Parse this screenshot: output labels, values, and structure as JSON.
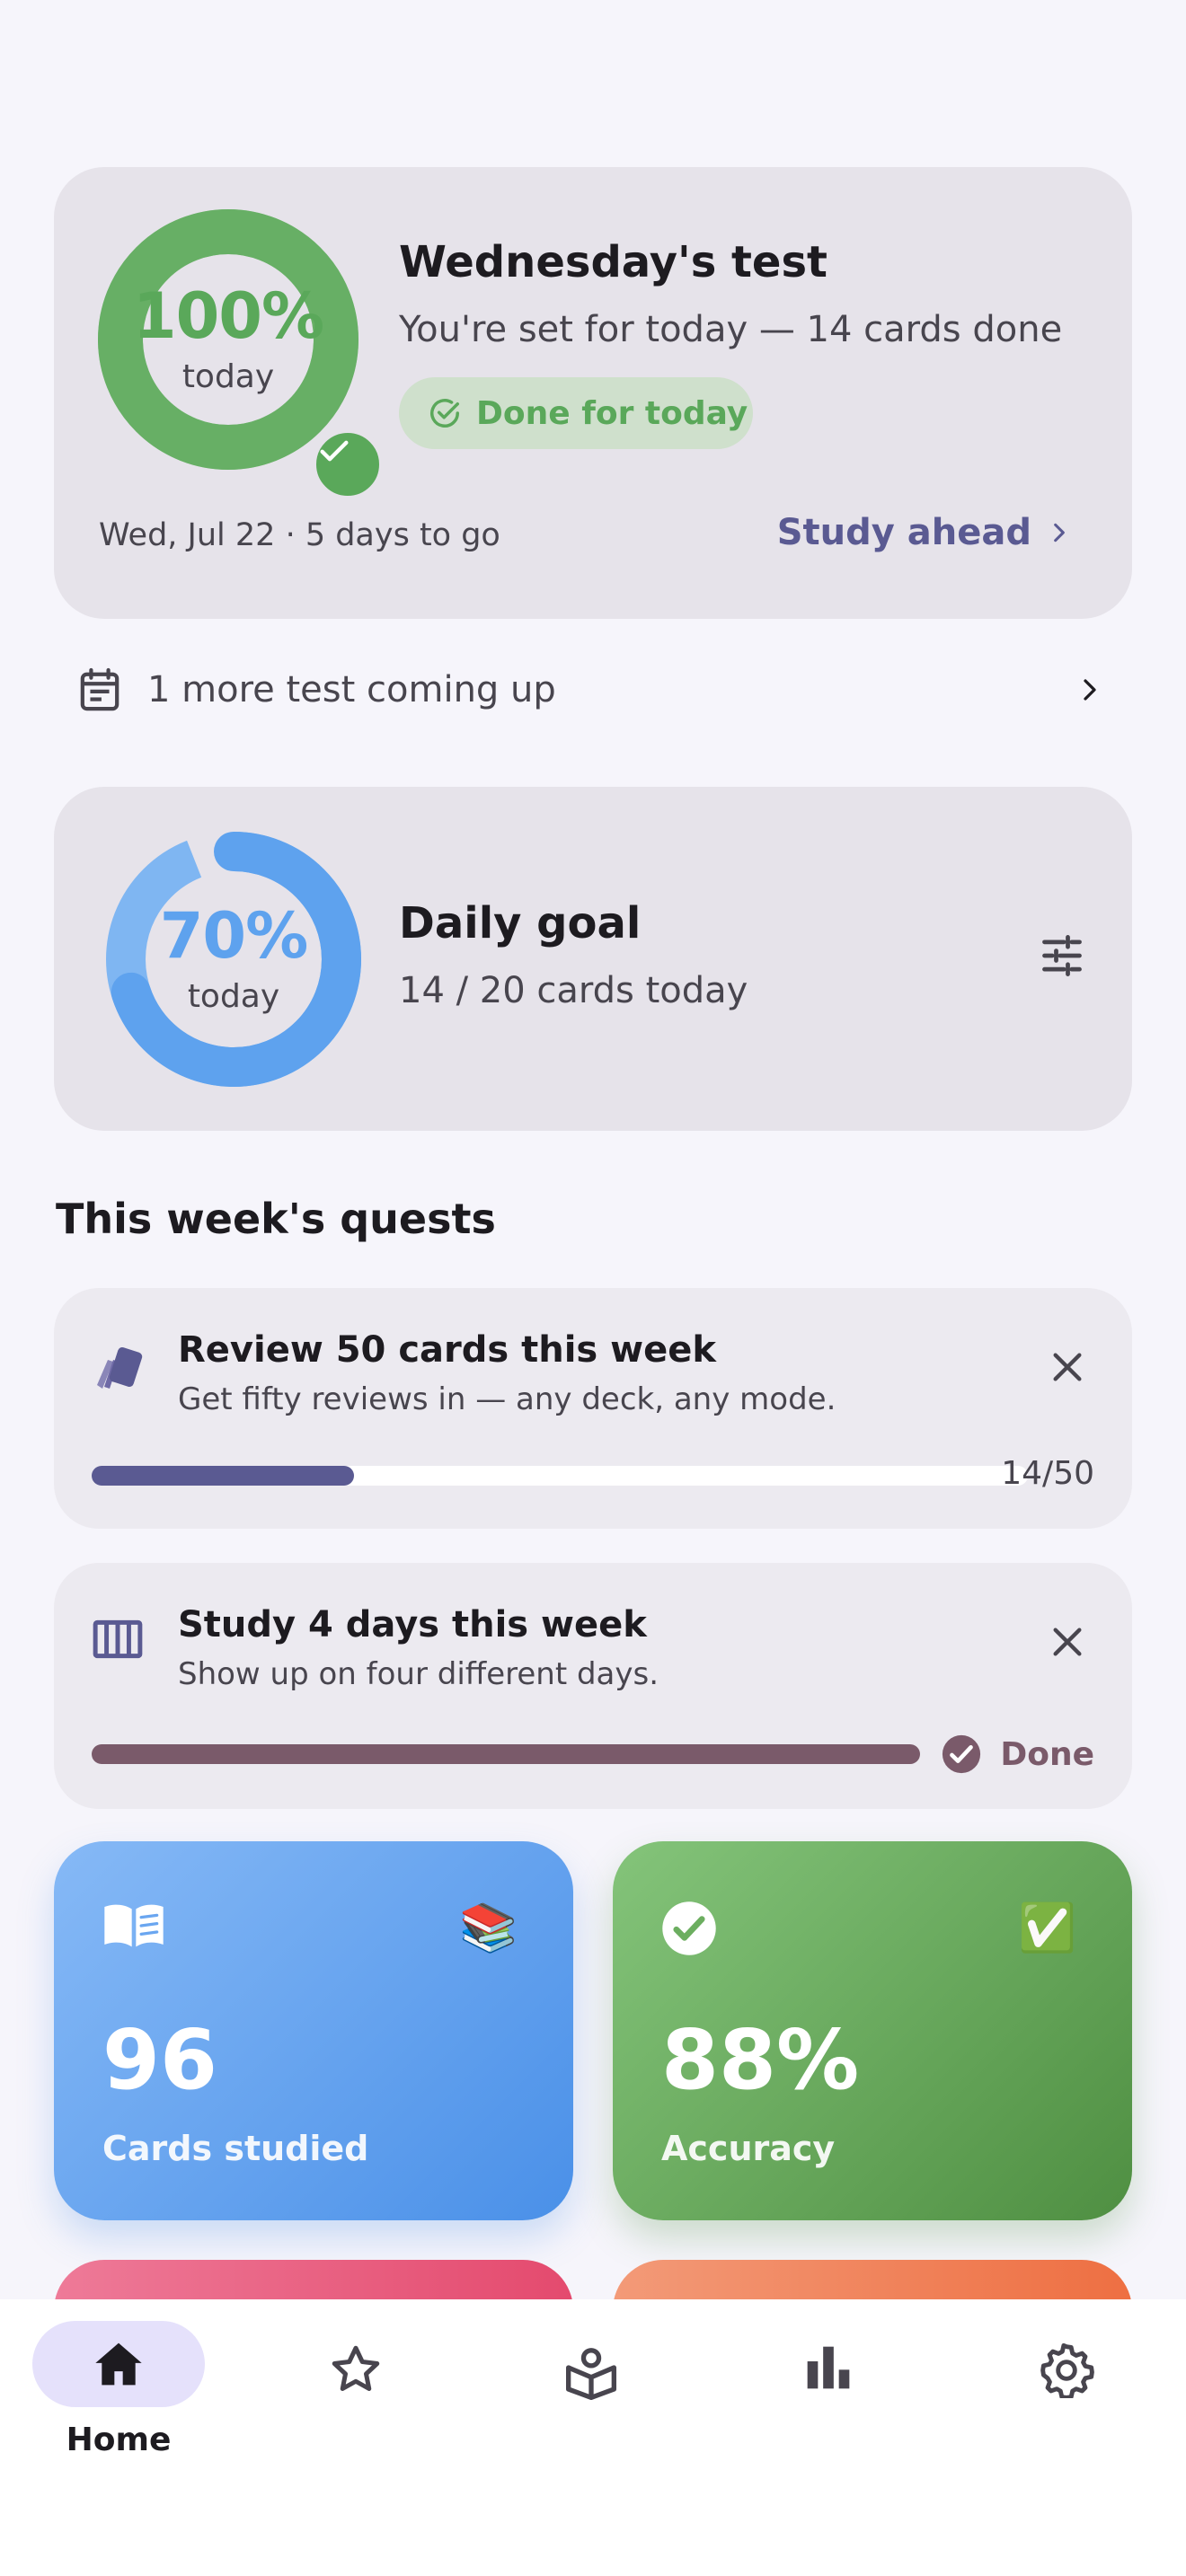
{
  "test_card": {
    "ring_percent": "100%",
    "ring_sub": "today",
    "progress": 1.0,
    "title": "Wednesday's test",
    "subtitle": "You're set for today — 14 cards done",
    "chip_label": "Done for today",
    "date_text": "Wed, Jul 22 · 5 days to go",
    "action_label": "Study ahead"
  },
  "upcoming": {
    "label": "1 more test coming up"
  },
  "goal_card": {
    "ring_percent": "70%",
    "ring_sub": "today",
    "progress": 0.7,
    "title": "Daily goal",
    "subtitle": "14 / 20 cards today"
  },
  "quests": {
    "section_title": "This week's quests",
    "items": [
      {
        "title": "Review 50 cards this week",
        "description": "Get fifty reviews in — any deck, any mode.",
        "progress": 0.28,
        "count": "14/50"
      },
      {
        "title": "Study 4 days this week",
        "description": "Show up on four different days.",
        "progress": 1.0,
        "status": "Done"
      }
    ]
  },
  "stats": [
    {
      "value": "96",
      "label": "Cards studied",
      "emoji": "📚"
    },
    {
      "value": "88%",
      "label": "Accuracy",
      "emoji": "✅"
    }
  ],
  "nav": {
    "home_label": "Home"
  },
  "colors": {
    "green": "#5aa85a",
    "blue": "#5ea2ee",
    "indigo": "#5a5a92",
    "mauve": "#7a5a6a"
  }
}
